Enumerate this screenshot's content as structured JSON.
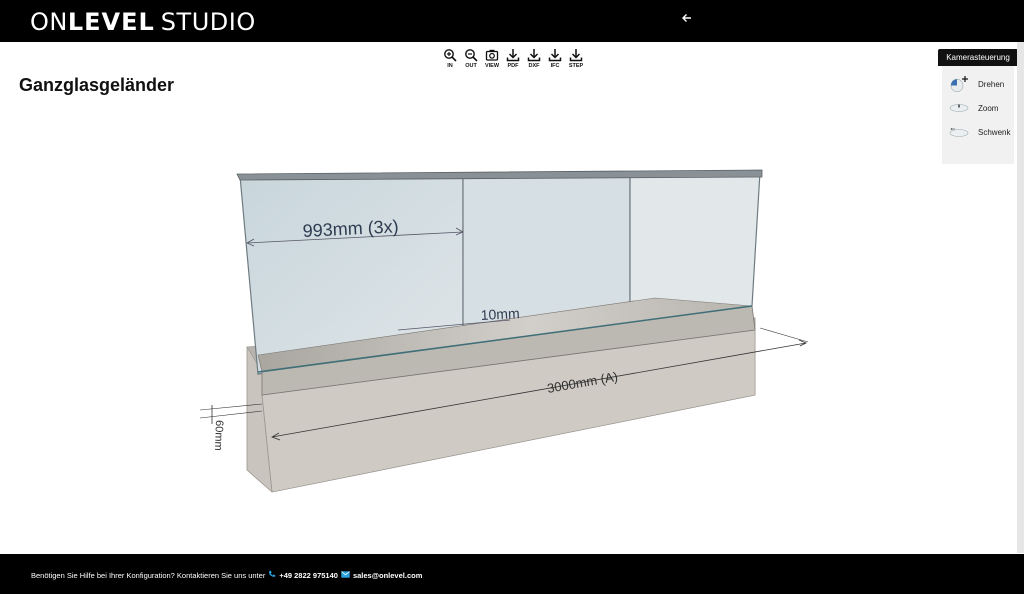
{
  "header": {
    "logo_on": "ON",
    "logo_level": "LEVEL",
    "logo_studio": "STUDIO",
    "back_icon": "arrow-left-icon"
  },
  "toolbar": {
    "items": [
      {
        "label": "IN",
        "icon": "zoom-in-icon"
      },
      {
        "label": "OUT",
        "icon": "zoom-out-icon"
      },
      {
        "label": "VIEW",
        "icon": "camera-icon"
      },
      {
        "label": "PDF",
        "icon": "download-icon"
      },
      {
        "label": "DXF",
        "icon": "download-icon"
      },
      {
        "label": "IFC",
        "icon": "download-icon"
      },
      {
        "label": "STEP",
        "icon": "download-icon"
      }
    ]
  },
  "page_title": "Ganzglasgeländer",
  "camera_panel": {
    "title": "Kamerasteuerung",
    "items": [
      {
        "label": "Drehen",
        "icon": "rotate-mouse-icon"
      },
      {
        "label": "Zoom",
        "icon": "zoom-mouse-icon"
      },
      {
        "label": "Schwenk",
        "icon": "pan-mouse-icon"
      }
    ]
  },
  "model": {
    "dim_panel_width": "993mm (3x)",
    "dim_gap": "10mm",
    "dim_length": "3000mm (A)",
    "dim_height": "60mm"
  },
  "footer": {
    "help_text": "Benötigen Sie Hilfe bei Ihrer Konfiguration? Kontaktieren Sie uns unter",
    "phone": "+49 2822 975140",
    "email": "sales@onlevel.com",
    "colors": {
      "phone_icon": "#29a3e0",
      "mail_icon": "#29a3e0"
    }
  }
}
